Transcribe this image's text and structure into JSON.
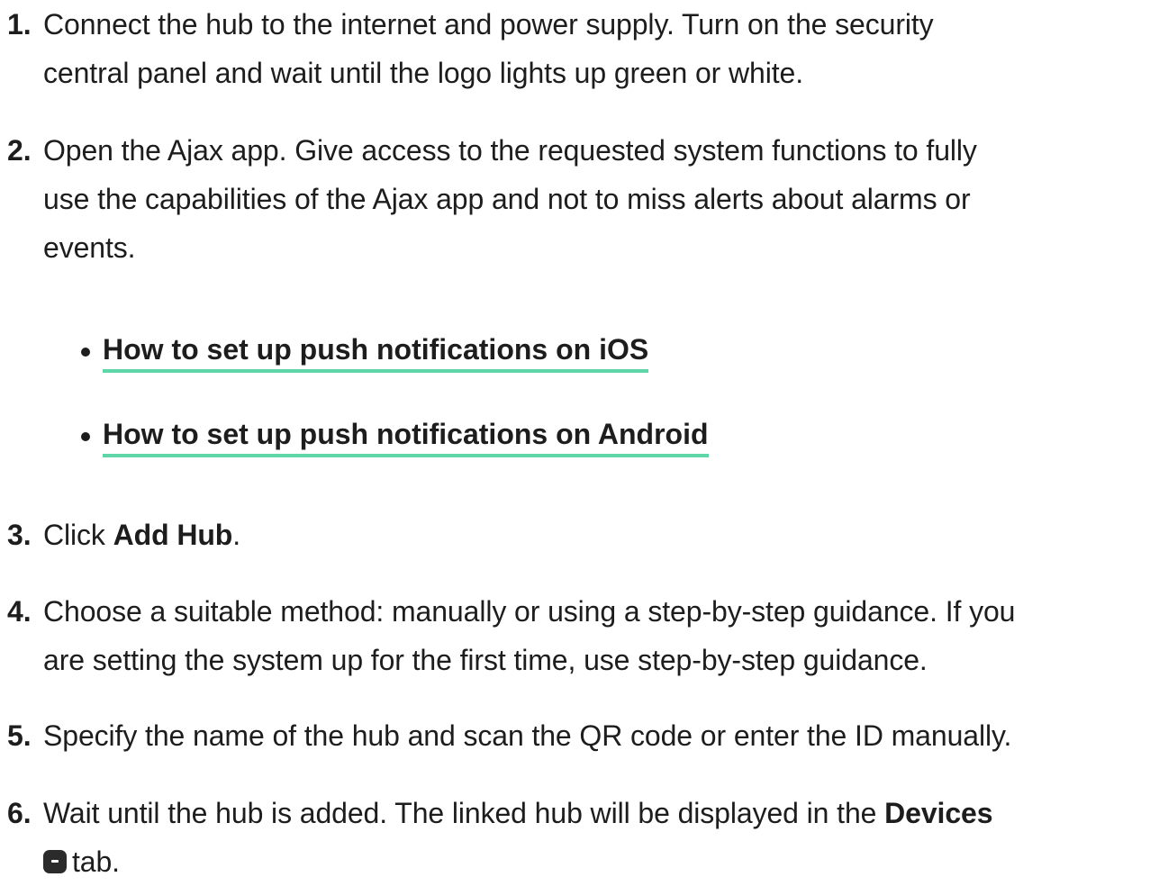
{
  "steps": [
    {
      "num": "1.",
      "text": "Connect the hub to the internet and power supply. Turn on the security",
      "cont": "central panel and wait until the logo lights up green or white."
    },
    {
      "num": "2.",
      "text": "Open the Ajax app. Give access to the requested system functions to fully",
      "cont1": "use the capabilities of the Ajax app and not to miss alerts about alarms or",
      "cont2": "events."
    },
    {
      "num": "3.",
      "pre": "Click ",
      "bold": "Add Hub",
      "post": "."
    },
    {
      "num": "4.",
      "text": "Choose a suitable method: manually or using a step-by-step guidance. If you",
      "cont": "are setting the system up for the first time, use step-by-step guidance."
    },
    {
      "num": "5.",
      "text": "Specify the name of the hub and scan the QR code or enter the ID manually."
    },
    {
      "num": "6.",
      "pre": "Wait until the hub is added. The linked hub will be displayed in the ",
      "bold": "Devices",
      "post": "tab."
    }
  ],
  "links": [
    {
      "label": "How to set up push notifications on iOS"
    },
    {
      "label": "How to set up push notifications on Android"
    }
  ],
  "icons": {
    "devices": "devices-tab-icon"
  },
  "colors": {
    "link_underline": "#5fd6a8",
    "text": "#1d1d1d"
  }
}
